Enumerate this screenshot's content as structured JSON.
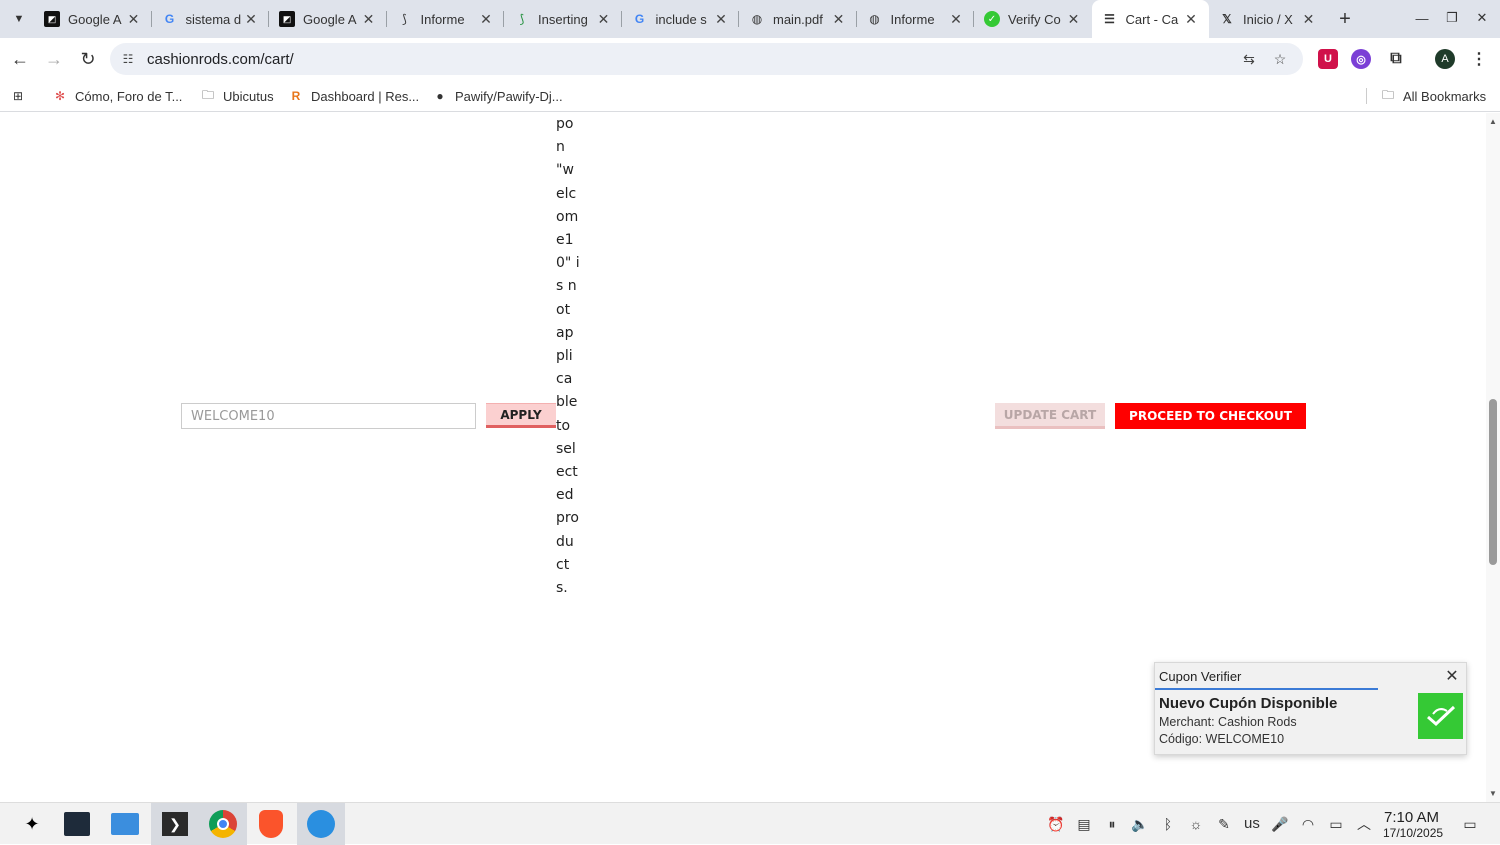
{
  "browser": {
    "tabs": [
      {
        "title": "Google A",
        "icon": "google-ads-icon"
      },
      {
        "title": "sistema d",
        "icon": "google-icon"
      },
      {
        "title": "Google A",
        "icon": "google-ads-icon"
      },
      {
        "title": "Informe",
        "icon": "informe-icon"
      },
      {
        "title": "Inserting",
        "icon": "inserting-icon"
      },
      {
        "title": "include s",
        "icon": "google-icon"
      },
      {
        "title": "main.pdf",
        "icon": "globe-icon"
      },
      {
        "title": "Informe",
        "icon": "globe-icon"
      },
      {
        "title": "Verify Co",
        "icon": "verify-icon"
      },
      {
        "title": "Cart - Ca",
        "icon": "cart-icon",
        "active": true
      },
      {
        "title": "Inicio / X",
        "icon": "x-icon"
      }
    ],
    "url": "cashionrods.com/cart/",
    "profile_initial": "A",
    "bookmarks": [
      {
        "label": "Cómo, Foro de T...",
        "icon": "como-icon"
      },
      {
        "label": "Ubicutus",
        "icon": "folder-icon"
      },
      {
        "label": "Dashboard | Res...",
        "icon": "r-icon"
      },
      {
        "label": "Pawify/Pawify-Dj...",
        "icon": "github-icon"
      }
    ],
    "all_bookmarks": "All Bookmarks"
  },
  "page": {
    "error_message": "pon \"welcome10\" is not applicable to selected products.",
    "coupon_input_value": "WELCOME10",
    "apply_label": "APPLY",
    "update_cart_label": "UPDATE CART",
    "checkout_label": "PROCEED TO CHECKOUT",
    "accent_color": "#ff0000"
  },
  "notification": {
    "app": "Cupon Verifier",
    "title": "Nuevo Cupón Disponible",
    "merchant": "Merchant: Cashion Rods",
    "code": "Código: WELCOME10"
  },
  "taskbar": {
    "keyboard_layout": "us",
    "time": "7:10 AM",
    "date": "17/10/2025"
  }
}
